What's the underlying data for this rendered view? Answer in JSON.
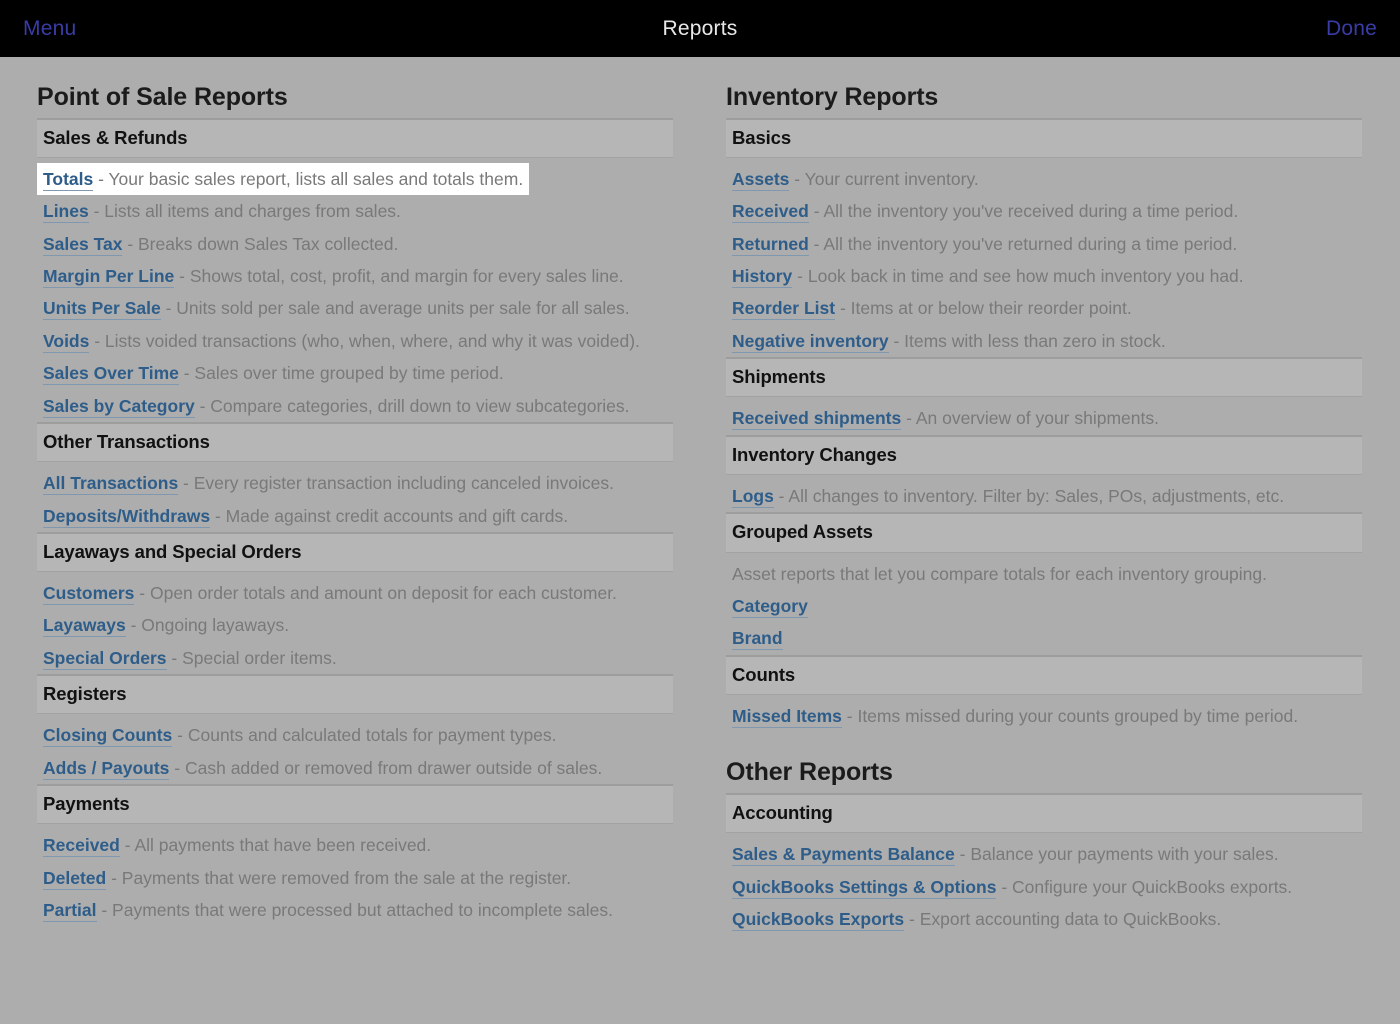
{
  "topbar": {
    "menu_label": "Menu",
    "title": "Reports",
    "done_label": "Done"
  },
  "colors": {
    "background": "#adadad",
    "section_band": "#b6b6b6",
    "link_blue": "#2e5d8a",
    "description_gray": "#797979",
    "topbar_bg": "#000000",
    "topbar_link": "#3a3ca6",
    "highlight_row": "#ffffff"
  },
  "columns": [
    {
      "title": "Point of Sale Reports",
      "sections": [
        {
          "header": "Sales & Refunds",
          "rows": [
            {
              "link": "Totals",
              "desc": "- Your basic sales report, lists all sales and totals them.",
              "highlighted": true
            },
            {
              "link": "Lines",
              "desc": "- Lists all items and charges from sales."
            },
            {
              "link": "Sales Tax",
              "desc": "- Breaks down Sales Tax collected."
            },
            {
              "link": "Margin Per Line",
              "desc": "- Shows total, cost, profit, and margin for every sales line."
            },
            {
              "link": "Units Per Sale",
              "desc": "- Units sold per sale and average units per sale for all sales."
            },
            {
              "link": "Voids",
              "desc": "- Lists voided transactions (who, when, where, and why it was voided)."
            },
            {
              "link": "Sales Over Time",
              "desc": "- Sales over time grouped by time period."
            },
            {
              "link": "Sales by Category",
              "desc": "- Compare categories, drill down to view subcategories."
            }
          ]
        },
        {
          "header": "Other Transactions",
          "rows": [
            {
              "link": "All Transactions",
              "desc": "- Every register transaction including canceled invoices."
            },
            {
              "link": "Deposits/Withdraws",
              "desc": "- Made against credit accounts and gift cards."
            }
          ]
        },
        {
          "header": "Layaways and Special Orders",
          "rows": [
            {
              "link": "Customers",
              "desc": "- Open order totals and amount on deposit for each customer."
            },
            {
              "link": "Layaways",
              "desc": "- Ongoing layaways."
            },
            {
              "link": "Special Orders",
              "desc": "- Special order items."
            }
          ]
        },
        {
          "header": "Registers",
          "rows": [
            {
              "link": "Closing Counts",
              "desc": "- Counts and calculated totals for payment types."
            },
            {
              "link": "Adds / Payouts",
              "desc": "- Cash added or removed from drawer outside of sales."
            }
          ]
        },
        {
          "header": "Payments",
          "rows": [
            {
              "link": "Received",
              "desc": "- All payments that have been received."
            },
            {
              "link": "Deleted",
              "desc": "- Payments that were removed from the sale at the register."
            },
            {
              "link": "Partial",
              "desc": "- Payments that were processed but attached to incomplete sales."
            }
          ]
        }
      ]
    },
    {
      "title": "Inventory Reports",
      "sections": [
        {
          "header": "Basics",
          "rows": [
            {
              "link": "Assets",
              "desc": "- Your current inventory."
            },
            {
              "link": "Received",
              "desc": "- All the inventory you've received during a time period."
            },
            {
              "link": "Returned",
              "desc": "- All the inventory you've returned during a time period."
            },
            {
              "link": "History",
              "desc": "- Look back in time and see how much inventory you had."
            },
            {
              "link": "Reorder List",
              "desc": "- Items at or below their reorder point."
            },
            {
              "link": "Negative inventory",
              "desc": "- Items with less than zero in stock."
            }
          ]
        },
        {
          "header": "Shipments",
          "rows": [
            {
              "link": "Received shipments",
              "desc": "- An overview of your shipments."
            }
          ]
        },
        {
          "header": "Inventory Changes",
          "rows": [
            {
              "link": "Logs",
              "desc": "- All changes to inventory. Filter by: Sales, POs, adjustments, etc."
            }
          ]
        },
        {
          "header": "Grouped Assets",
          "rows": [
            {
              "text": "Asset reports that let you compare totals for each inventory grouping."
            },
            {
              "link": "Category",
              "desc": ""
            },
            {
              "link": "Brand",
              "desc": ""
            }
          ]
        },
        {
          "header": "Counts",
          "rows": [
            {
              "link": "Missed Items",
              "desc": "- Items missed during your counts grouped by time period."
            }
          ]
        }
      ]
    },
    {
      "title": "Other Reports",
      "second_group_in_column": 1,
      "sections": [
        {
          "header": "Accounting",
          "rows": [
            {
              "link": "Sales & Payments Balance",
              "desc": "- Balance your payments with your sales."
            },
            {
              "link": "QuickBooks Settings & Options",
              "desc": "- Configure your QuickBooks exports."
            },
            {
              "link": "QuickBooks Exports",
              "desc": "- Export accounting data to QuickBooks."
            }
          ]
        }
      ]
    }
  ]
}
